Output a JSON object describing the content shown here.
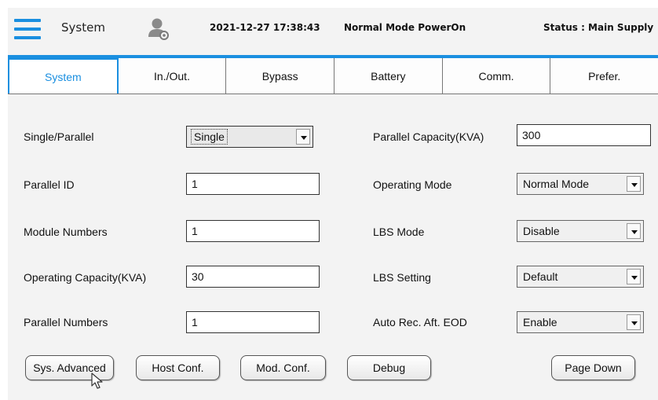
{
  "header": {
    "title": "System",
    "datetime": "2021-12-27 17:38:43",
    "mode": "Normal Mode  PowerOn",
    "status": "Status : Main Supply"
  },
  "icons": {
    "menu": "hamburger-menu-icon",
    "user": "user-settings-icon",
    "dropdown": "chevron-down-icon",
    "cursor": "mouse-pointer-icon"
  },
  "colors": {
    "accent": "#1a8fe0",
    "background": "#f3f3f3"
  },
  "tabs": [
    {
      "label": "System",
      "active": true
    },
    {
      "label": "In./Out.",
      "active": false
    },
    {
      "label": "Bypass",
      "active": false
    },
    {
      "label": "Battery",
      "active": false
    },
    {
      "label": "Comm.",
      "active": false
    },
    {
      "label": "Prefer.",
      "active": false
    }
  ],
  "form": {
    "left": {
      "single_parallel": {
        "label": "Single/Parallel",
        "value": "Single"
      },
      "parallel_id": {
        "label": "Parallel ID",
        "value": "1"
      },
      "module_numbers": {
        "label": "Module Numbers",
        "value": "1"
      },
      "operating_capacity": {
        "label": "Operating Capacity(KVA)",
        "value": "30"
      },
      "parallel_numbers": {
        "label": "Parallel Numbers",
        "value": "1"
      }
    },
    "right": {
      "parallel_capacity": {
        "label": "Parallel Capacity(KVA)",
        "value": "300"
      },
      "operating_mode": {
        "label": "Operating Mode",
        "value": "Normal Mode"
      },
      "lbs_mode": {
        "label": "LBS Mode",
        "value": "Disable"
      },
      "lbs_setting": {
        "label": "LBS Setting",
        "value": "Default"
      },
      "auto_rec": {
        "label": "Auto Rec. Aft. EOD",
        "value": "Enable"
      }
    }
  },
  "buttons": {
    "sys_advanced": "Sys. Advanced",
    "host_conf": "Host Conf.",
    "mod_conf": "Mod. Conf.",
    "debug": "Debug",
    "page_down": "Page Down"
  }
}
